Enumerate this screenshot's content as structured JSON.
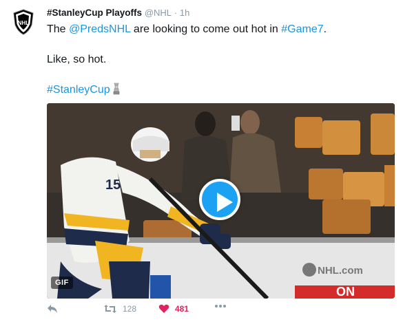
{
  "tweet": {
    "display_name": "#StanleyCup Playoffs",
    "handle": "@NHL",
    "separator": "·",
    "time": "1h",
    "line1": {
      "pre": "The ",
      "mention": "@PredsNHL",
      "mid": " are looking to come out hot in ",
      "hashtag": "#Game7",
      "post": "."
    },
    "line2": "Like, so hot.",
    "hashtag_line": "#StanleyCup",
    "emoji_icon": "trophy-cup-icon"
  },
  "media": {
    "badge": "GIF",
    "watermark": "NHL.com",
    "jersey_number": "15",
    "play_icon": "play-icon"
  },
  "actions": {
    "reply_icon": "reply-icon",
    "retweet_icon": "retweet-icon",
    "retweets": "128",
    "like_icon": "heart-icon",
    "likes": "481",
    "more_icon": "more-icon"
  },
  "colors": {
    "link": "#1b95e0",
    "play_button": "#1da1f2",
    "like": "#e0245e",
    "muted": "#8899a6"
  }
}
